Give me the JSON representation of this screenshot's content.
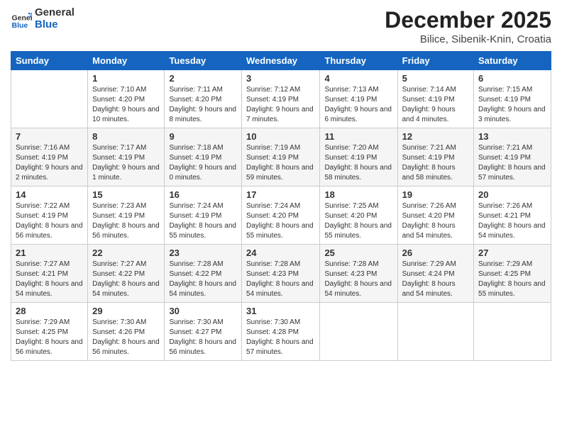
{
  "header": {
    "logo_general": "General",
    "logo_blue": "Blue",
    "month": "December 2025",
    "location": "Bilice, Sibenik-Knin, Croatia"
  },
  "days_of_week": [
    "Sunday",
    "Monday",
    "Tuesday",
    "Wednesday",
    "Thursday",
    "Friday",
    "Saturday"
  ],
  "weeks": [
    [
      {
        "day": "",
        "sunrise": "",
        "sunset": "",
        "daylight": ""
      },
      {
        "day": "1",
        "sunrise": "Sunrise: 7:10 AM",
        "sunset": "Sunset: 4:20 PM",
        "daylight": "Daylight: 9 hours and 10 minutes."
      },
      {
        "day": "2",
        "sunrise": "Sunrise: 7:11 AM",
        "sunset": "Sunset: 4:20 PM",
        "daylight": "Daylight: 9 hours and 8 minutes."
      },
      {
        "day": "3",
        "sunrise": "Sunrise: 7:12 AM",
        "sunset": "Sunset: 4:19 PM",
        "daylight": "Daylight: 9 hours and 7 minutes."
      },
      {
        "day": "4",
        "sunrise": "Sunrise: 7:13 AM",
        "sunset": "Sunset: 4:19 PM",
        "daylight": "Daylight: 9 hours and 6 minutes."
      },
      {
        "day": "5",
        "sunrise": "Sunrise: 7:14 AM",
        "sunset": "Sunset: 4:19 PM",
        "daylight": "Daylight: 9 hours and 4 minutes."
      },
      {
        "day": "6",
        "sunrise": "Sunrise: 7:15 AM",
        "sunset": "Sunset: 4:19 PM",
        "daylight": "Daylight: 9 hours and 3 minutes."
      }
    ],
    [
      {
        "day": "7",
        "sunrise": "Sunrise: 7:16 AM",
        "sunset": "Sunset: 4:19 PM",
        "daylight": "Daylight: 9 hours and 2 minutes."
      },
      {
        "day": "8",
        "sunrise": "Sunrise: 7:17 AM",
        "sunset": "Sunset: 4:19 PM",
        "daylight": "Daylight: 9 hours and 1 minute."
      },
      {
        "day": "9",
        "sunrise": "Sunrise: 7:18 AM",
        "sunset": "Sunset: 4:19 PM",
        "daylight": "Daylight: 9 hours and 0 minutes."
      },
      {
        "day": "10",
        "sunrise": "Sunrise: 7:19 AM",
        "sunset": "Sunset: 4:19 PM",
        "daylight": "Daylight: 8 hours and 59 minutes."
      },
      {
        "day": "11",
        "sunrise": "Sunrise: 7:20 AM",
        "sunset": "Sunset: 4:19 PM",
        "daylight": "Daylight: 8 hours and 58 minutes."
      },
      {
        "day": "12",
        "sunrise": "Sunrise: 7:21 AM",
        "sunset": "Sunset: 4:19 PM",
        "daylight": "Daylight: 8 hours and 58 minutes."
      },
      {
        "day": "13",
        "sunrise": "Sunrise: 7:21 AM",
        "sunset": "Sunset: 4:19 PM",
        "daylight": "Daylight: 8 hours and 57 minutes."
      }
    ],
    [
      {
        "day": "14",
        "sunrise": "Sunrise: 7:22 AM",
        "sunset": "Sunset: 4:19 PM",
        "daylight": "Daylight: 8 hours and 56 minutes."
      },
      {
        "day": "15",
        "sunrise": "Sunrise: 7:23 AM",
        "sunset": "Sunset: 4:19 PM",
        "daylight": "Daylight: 8 hours and 56 minutes."
      },
      {
        "day": "16",
        "sunrise": "Sunrise: 7:24 AM",
        "sunset": "Sunset: 4:19 PM",
        "daylight": "Daylight: 8 hours and 55 minutes."
      },
      {
        "day": "17",
        "sunrise": "Sunrise: 7:24 AM",
        "sunset": "Sunset: 4:20 PM",
        "daylight": "Daylight: 8 hours and 55 minutes."
      },
      {
        "day": "18",
        "sunrise": "Sunrise: 7:25 AM",
        "sunset": "Sunset: 4:20 PM",
        "daylight": "Daylight: 8 hours and 55 minutes."
      },
      {
        "day": "19",
        "sunrise": "Sunrise: 7:26 AM",
        "sunset": "Sunset: 4:20 PM",
        "daylight": "Daylight: 8 hours and 54 minutes."
      },
      {
        "day": "20",
        "sunrise": "Sunrise: 7:26 AM",
        "sunset": "Sunset: 4:21 PM",
        "daylight": "Daylight: 8 hours and 54 minutes."
      }
    ],
    [
      {
        "day": "21",
        "sunrise": "Sunrise: 7:27 AM",
        "sunset": "Sunset: 4:21 PM",
        "daylight": "Daylight: 8 hours and 54 minutes."
      },
      {
        "day": "22",
        "sunrise": "Sunrise: 7:27 AM",
        "sunset": "Sunset: 4:22 PM",
        "daylight": "Daylight: 8 hours and 54 minutes."
      },
      {
        "day": "23",
        "sunrise": "Sunrise: 7:28 AM",
        "sunset": "Sunset: 4:22 PM",
        "daylight": "Daylight: 8 hours and 54 minutes."
      },
      {
        "day": "24",
        "sunrise": "Sunrise: 7:28 AM",
        "sunset": "Sunset: 4:23 PM",
        "daylight": "Daylight: 8 hours and 54 minutes."
      },
      {
        "day": "25",
        "sunrise": "Sunrise: 7:28 AM",
        "sunset": "Sunset: 4:23 PM",
        "daylight": "Daylight: 8 hours and 54 minutes."
      },
      {
        "day": "26",
        "sunrise": "Sunrise: 7:29 AM",
        "sunset": "Sunset: 4:24 PM",
        "daylight": "Daylight: 8 hours and 54 minutes."
      },
      {
        "day": "27",
        "sunrise": "Sunrise: 7:29 AM",
        "sunset": "Sunset: 4:25 PM",
        "daylight": "Daylight: 8 hours and 55 minutes."
      }
    ],
    [
      {
        "day": "28",
        "sunrise": "Sunrise: 7:29 AM",
        "sunset": "Sunset: 4:25 PM",
        "daylight": "Daylight: 8 hours and 56 minutes."
      },
      {
        "day": "29",
        "sunrise": "Sunrise: 7:30 AM",
        "sunset": "Sunset: 4:26 PM",
        "daylight": "Daylight: 8 hours and 56 minutes."
      },
      {
        "day": "30",
        "sunrise": "Sunrise: 7:30 AM",
        "sunset": "Sunset: 4:27 PM",
        "daylight": "Daylight: 8 hours and 56 minutes."
      },
      {
        "day": "31",
        "sunrise": "Sunrise: 7:30 AM",
        "sunset": "Sunset: 4:28 PM",
        "daylight": "Daylight: 8 hours and 57 minutes."
      },
      {
        "day": "",
        "sunrise": "",
        "sunset": "",
        "daylight": ""
      },
      {
        "day": "",
        "sunrise": "",
        "sunset": "",
        "daylight": ""
      },
      {
        "day": "",
        "sunrise": "",
        "sunset": "",
        "daylight": ""
      }
    ]
  ]
}
